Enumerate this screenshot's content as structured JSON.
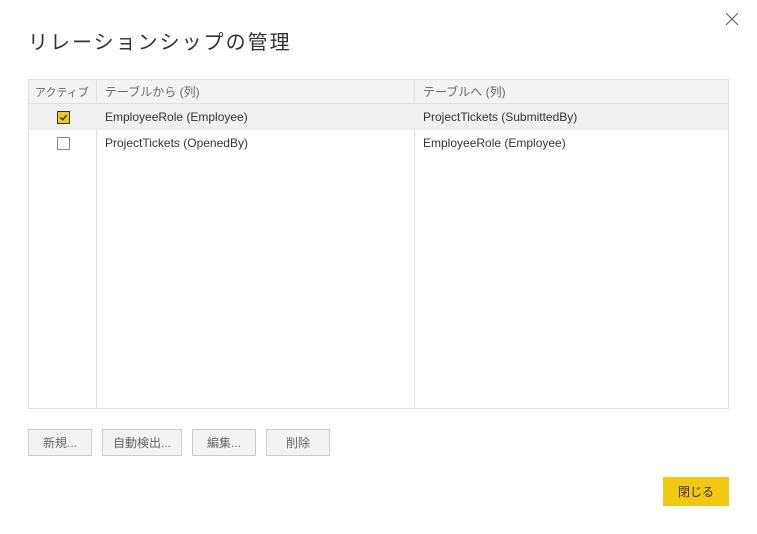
{
  "dialog": {
    "title": "リレーションシップの管理"
  },
  "grid": {
    "headers": {
      "active": "アクティブ",
      "from": "テーブルから (列)",
      "to": "テーブルへ (列)"
    },
    "rows": [
      {
        "active": true,
        "selected": true,
        "from": "EmployeeRole (Employee)",
        "to": "ProjectTickets (SubmittedBy)"
      },
      {
        "active": false,
        "selected": false,
        "from": "ProjectTickets (OpenedBy)",
        "to": "EmployeeRole (Employee)"
      }
    ]
  },
  "buttons": {
    "new": "新規...",
    "autodetect": "自動検出...",
    "edit": "編集...",
    "delete": "削除",
    "close": "閉じる"
  }
}
